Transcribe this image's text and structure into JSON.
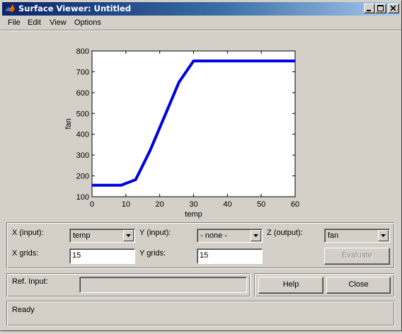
{
  "window": {
    "title": "Surface Viewer: Untitled"
  },
  "menu": {
    "items": [
      "File",
      "Edit",
      "View",
      "Options"
    ]
  },
  "controls": {
    "x_input_label": "X (input):",
    "x_input_value": "temp",
    "y_input_label": "Y (input):",
    "y_input_value": "- none -",
    "z_output_label": "Z (output):",
    "z_output_value": "fan",
    "x_grids_label": "X grids:",
    "x_grids_value": "15",
    "y_grids_label": "Y grids:",
    "y_grids_value": "15",
    "evaluate_label": "Evaluate",
    "ref_input_label": "Ref. Input:",
    "ref_input_value": "",
    "help_label": "Help",
    "close_label": "Close",
    "status": "Ready"
  },
  "colors": {
    "line": "#0000e0",
    "title_bar_start": "#0a246a",
    "title_bar_end": "#a6caf0"
  },
  "chart_data": {
    "type": "line",
    "xlabel": "temp",
    "ylabel": "fan",
    "xlim": [
      0,
      60
    ],
    "ylim": [
      100,
      800
    ],
    "x_ticks": [
      0,
      10,
      20,
      30,
      40,
      50,
      60
    ],
    "y_ticks": [
      100,
      200,
      300,
      400,
      500,
      600,
      700,
      800
    ],
    "grid": false,
    "series": [
      {
        "x": [
          0,
          4.3,
          8.6,
          12.9,
          17.1,
          21.4,
          25.7,
          30,
          34.3,
          38.6,
          42.9,
          47.1,
          51.4,
          55.7,
          60
        ],
        "values": [
          155,
          155,
          155,
          182,
          320,
          485,
          650,
          752,
          752,
          752,
          752,
          752,
          752,
          752,
          752
        ]
      }
    ]
  }
}
